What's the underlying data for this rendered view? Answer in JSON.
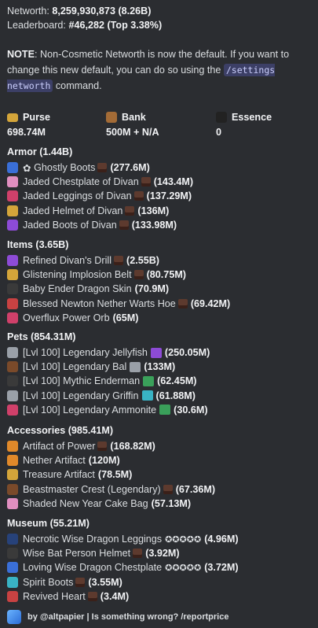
{
  "header": {
    "networth_label": "Networth:",
    "networth_value": "8,259,930,873 (8.26B)",
    "leaderboard_label": "Leaderboard:",
    "leaderboard_value": "#46,282 (Top 3.38%)"
  },
  "note": {
    "label": "NOTE",
    "text_before": ": Non-Cosmetic Networth is now the default. If you want to change this new default, you can do so using the ",
    "command": "/settings networth",
    "text_after": " command."
  },
  "stats": [
    {
      "label": "Purse",
      "value": "698.74M",
      "icon": "gold-ingot-icon"
    },
    {
      "label": "Bank",
      "value": "500M + N/A",
      "icon": "chest-icon"
    },
    {
      "label": "Essence",
      "value": "0",
      "icon": "wither-essence-icon"
    }
  ],
  "sections": [
    {
      "title": "Armor (1.44B)",
      "items": [
        {
          "prefix": "✿ ",
          "name": "Ghostly Boots",
          "value": "(277.6M)",
          "icon": "ghostly-boots-icon",
          "color": "blue"
        },
        {
          "name": "Jaded Chestplate of Divan",
          "value": "(143.4M)",
          "icon": "divan-chestplate-icon",
          "color": "pink"
        },
        {
          "name": "Jaded Leggings of Divan",
          "value": "(137.29M)",
          "icon": "divan-leggings-icon",
          "color": "magenta"
        },
        {
          "name": "Jaded Helmet of Divan",
          "value": "(136M)",
          "icon": "divan-helmet-icon",
          "color": "gold"
        },
        {
          "name": "Jaded Boots of Divan",
          "value": "(133.98M)",
          "icon": "divan-boots-icon",
          "color": "purple"
        }
      ]
    },
    {
      "title": "Items (3.65B)",
      "items": [
        {
          "name": "Refined Divan's Drill",
          "value": "(2.55B)",
          "icon": "drill-icon",
          "color": "purple"
        },
        {
          "name": "Glistening Implosion Belt",
          "value": "(80.75M)",
          "icon": "belt-icon",
          "color": "gold"
        },
        {
          "name": "Baby Ender Dragon Skin",
          "value": "(70.9M)",
          "icon": "dragon-skin-icon",
          "color": "dark",
          "no_gem": true
        },
        {
          "name": "Blessed Newton Nether Warts Hoe",
          "value": "(69.42M)",
          "icon": "hoe-icon",
          "color": "red"
        },
        {
          "name": "Overflux Power Orb",
          "value": "(65M)",
          "icon": "power-orb-icon",
          "color": "magenta",
          "no_gem": true
        }
      ]
    },
    {
      "title": "Pets (854.31M)",
      "items": [
        {
          "name": "[Lvl 100] Legendary Jellyfish",
          "value": "(250.05M)",
          "icon": "jellyfish-icon",
          "color": "grey",
          "pet_item": "purple"
        },
        {
          "name": "[Lvl 100] Legendary Bal",
          "value": "(133M)",
          "icon": "bal-icon",
          "color": "brown",
          "pet_item": "grey"
        },
        {
          "name": "[Lvl 100] Mythic Enderman",
          "value": "(62.45M)",
          "icon": "enderman-icon",
          "color": "dark",
          "pet_item": "green"
        },
        {
          "name": "[Lvl 100] Legendary Griffin",
          "value": "(61.88M)",
          "icon": "griffin-icon",
          "color": "grey",
          "pet_item": "cyan"
        },
        {
          "name": "[Lvl 100] Legendary Ammonite",
          "value": "(30.6M)",
          "icon": "ammonite-icon",
          "color": "magenta",
          "pet_item": "green"
        }
      ]
    },
    {
      "title": "Accessories (985.41M)",
      "items": [
        {
          "name": "Artifact of Power",
          "value": "(168.82M)",
          "icon": "artifact-power-icon",
          "color": "orange"
        },
        {
          "name": "Nether Artifact",
          "value": "(120M)",
          "icon": "nether-artifact-icon",
          "color": "orange",
          "no_gem": true
        },
        {
          "name": "Treasure Artifact",
          "value": "(78.5M)",
          "icon": "treasure-artifact-icon",
          "color": "gold",
          "no_gem": true
        },
        {
          "name": "Beastmaster Crest (Legendary)",
          "value": "(67.36M)",
          "icon": "beastmaster-crest-icon",
          "color": "brown"
        },
        {
          "name": "Shaded New Year Cake Bag",
          "value": "(57.13M)",
          "icon": "cake-bag-icon",
          "color": "pink",
          "no_gem": true
        }
      ]
    },
    {
      "title": "Museum (55.21M)",
      "items": [
        {
          "name": "Necrotic Wise Dragon Leggings",
          "stars": "✪✪✪✪✪",
          "value": "(4.96M)",
          "icon": "wise-leggings-icon",
          "color": "navy"
        },
        {
          "name": "Wise Bat Person Helmet",
          "value": "(3.92M)",
          "icon": "bat-helmet-icon",
          "color": "dark"
        },
        {
          "name": "Loving Wise Dragon Chestplate",
          "stars": "✪✪✪✪✪",
          "value": "(3.72M)",
          "icon": "wise-chestplate-icon",
          "color": "blue"
        },
        {
          "name": "Spirit Boots",
          "value": "(3.55M)",
          "icon": "spirit-boots-icon",
          "color": "cyan"
        },
        {
          "name": "Revived Heart",
          "value": "(3.4M)",
          "icon": "revived-heart-icon",
          "color": "red"
        }
      ]
    }
  ],
  "footer": {
    "text": "by @altpapier | Is something wrong? /reportprice"
  }
}
